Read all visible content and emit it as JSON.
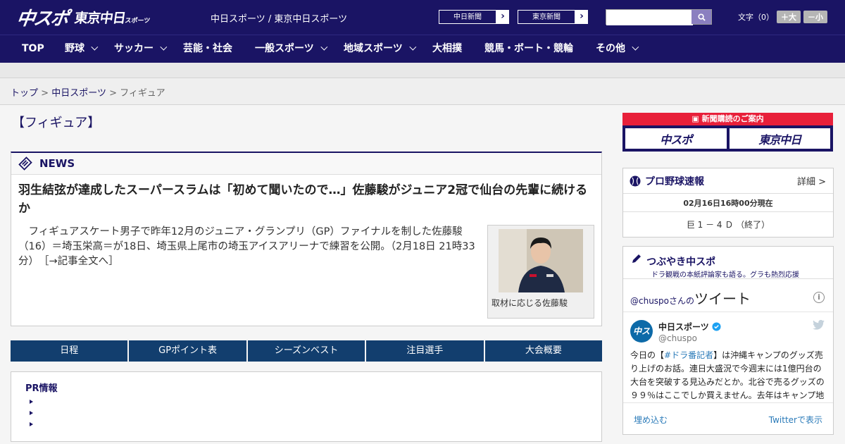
{
  "header": {
    "logo_chuspo": "中スポ",
    "logo_tokyo": "東京中日",
    "logo_tokyo_small": "スポーツ",
    "site_links": "中日スポーツ / 東京中日スポーツ",
    "chunichi_shimbun": "中日新聞",
    "tokyo_shimbun": "東京新聞",
    "search_placeholder": "",
    "font_label": "文字（0）",
    "font_bigger": "＋大",
    "font_smaller": "－小"
  },
  "nav": {
    "items": [
      {
        "label": "TOP",
        "dropdown": false
      },
      {
        "label": "野球",
        "dropdown": true
      },
      {
        "label": "サッカー",
        "dropdown": true
      },
      {
        "label": "芸能・社会",
        "dropdown": false
      },
      {
        "label": "一般スポーツ",
        "dropdown": true
      },
      {
        "label": "地域スポーツ",
        "dropdown": true
      },
      {
        "label": "大相撲",
        "dropdown": false
      },
      {
        "label": "競馬・ボート・競輪",
        "dropdown": false
      },
      {
        "label": "その他",
        "dropdown": true
      }
    ]
  },
  "breadcrumb": {
    "top": "トップ",
    "sep": ">",
    "chunichi": "中日スポーツ",
    "current": "フィギュア"
  },
  "page": {
    "title": "【フィギュア】"
  },
  "news": {
    "label": "NEWS",
    "headline": "羽生結弦が達成したスーパースラムは「初めて聞いたので…」佐藤駿がジュニア2冠で仙台の先輩に続けるか",
    "body": "フィギュアスケート男子で昨年12月のジュニア・グランプリ（GP）ファイナルを制した佐藤駿（16）＝埼玉栄高＝が18日、埼玉県上尾市の埼玉アイスアリーナで練習を公開。（2月18日 21時33分）",
    "more_link": "［→記事全文へ］",
    "photo_caption": "取材に応じる佐藤駿"
  },
  "tabs": [
    "日程",
    "GPポイント表",
    "シーズンベスト",
    "注目選手",
    "大会概要"
  ],
  "pr": {
    "title": "PR情報"
  },
  "subscribe": {
    "banner": "新聞購読のご案内",
    "logo1": "中スポ",
    "logo2": "東京中日"
  },
  "baseball": {
    "title": "プロ野球速報",
    "detail": "詳細 >",
    "updated": "02月16日16時00分現在",
    "score": "巨 1 － 4 Ｄ （終了）"
  },
  "tsubuyaki": {
    "title": "つぶやき中スポ",
    "subtitle": "ドラ観戦の本紙評論家も語る。グラも熱烈応援",
    "tweets_by_handle": "@chuspo",
    "tweets_by_suffix": "さんの",
    "tweets_word": "ツイート",
    "account_name": "中日スポーツ",
    "account_handle": "@chuspo",
    "avatar_text": "中スポ",
    "tweet_pre": "今日の【",
    "tweet_hashtag": "#ドラ番記者",
    "tweet_post": "】は沖縄キャンプのグッズ売り上げのお話。連日大盛況で今週末には1億円台の大台を突破する見込みだとか。北谷で売るグッズの９９％はここでしか買えません。去年はキャンプ地",
    "embed": "埋め込む",
    "view_on_twitter": "Twitterで表示"
  }
}
